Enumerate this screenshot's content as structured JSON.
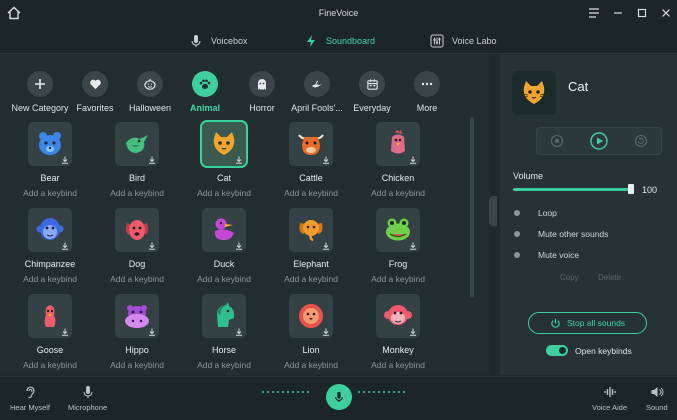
{
  "window": {
    "title": "FineVoice"
  },
  "tabs": [
    {
      "label": "Voicebox",
      "icon": "microphone-icon"
    },
    {
      "label": "Soundboard",
      "icon": "lightning-icon"
    },
    {
      "label": "Voice Labo",
      "icon": "sliders-icon"
    }
  ],
  "categories": [
    {
      "label": "New Category",
      "icon": "plus-icon"
    },
    {
      "label": "Favorites",
      "icon": "heart-icon"
    },
    {
      "label": "Halloween",
      "icon": "pumpkin-icon"
    },
    {
      "label": "Animal",
      "icon": "paw-icon"
    },
    {
      "label": "Horror",
      "icon": "ghost-icon"
    },
    {
      "label": "April Fools'...",
      "icon": "genie-lamp-icon"
    },
    {
      "label": "Everyday",
      "icon": "calendar-icon"
    },
    {
      "label": "More",
      "icon": "more-icon"
    }
  ],
  "sounds": [
    {
      "name": "Bear",
      "keybind": "Add a keybind",
      "color": "#3b86e8"
    },
    {
      "name": "Bird",
      "keybind": "Add a keybind",
      "color": "#46c07e"
    },
    {
      "name": "Cat",
      "keybind": "Add a keybind",
      "color": "#f0a531"
    },
    {
      "name": "Cattle",
      "keybind": "Add a keybind",
      "color": "#e86a2c"
    },
    {
      "name": "Chicken",
      "keybind": "Add a keybind",
      "color": "#e06a8a"
    },
    {
      "name": "Chimpanzee",
      "keybind": "Add a keybind",
      "color": "#3b6ae0"
    },
    {
      "name": "Dog",
      "keybind": "Add a keybind",
      "color": "#ee5b6c"
    },
    {
      "name": "Duck",
      "keybind": "Add a keybind",
      "color": "#c447d8"
    },
    {
      "name": "Elephant",
      "keybind": "Add a keybind",
      "color": "#f39c2c"
    },
    {
      "name": "Frog",
      "keybind": "Add a keybind",
      "color": "#6fcf4a"
    },
    {
      "name": "Goose",
      "keybind": "Add a keybind",
      "color": "#ee5b6c"
    },
    {
      "name": "Hippo",
      "keybind": "Add a keybind",
      "color": "#a24bd6"
    },
    {
      "name": "Horse",
      "keybind": "Add a keybind",
      "color": "#2fbf8f"
    },
    {
      "name": "Lion",
      "keybind": "Add a keybind",
      "color": "#e8524a"
    },
    {
      "name": "Monkey",
      "keybind": "Add a keybind",
      "color": "#ee5b6c"
    }
  ],
  "preview": {
    "name": "Cat"
  },
  "volume": {
    "label": "Volume",
    "value": "100",
    "level": 100
  },
  "options": [
    {
      "label": "Loop"
    },
    {
      "label": "Mute other sounds"
    },
    {
      "label": "Mute voice"
    }
  ],
  "actions": {
    "copy": "Copy",
    "delete": "Delete",
    "stop_all": "Stop all sounds",
    "open_keybinds": "Open keybinds"
  },
  "bottom": {
    "hear_myself": "Hear Myself",
    "microphone": "Microphone",
    "voice_aide": "Voice Aide",
    "sound": "Sound"
  },
  "colors": {
    "accent": "#3ecf9f"
  }
}
